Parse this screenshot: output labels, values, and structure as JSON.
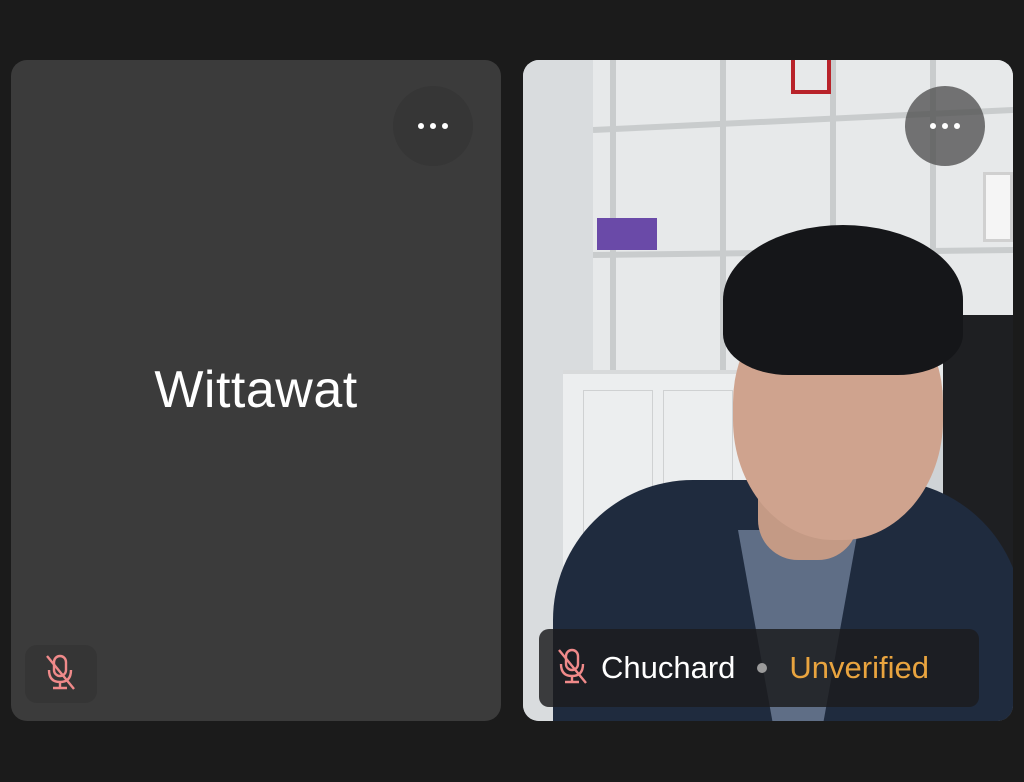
{
  "participants": [
    {
      "name": "Wittawat",
      "video": false,
      "muted": true,
      "icons": {
        "more": "more-horizontal-icon",
        "mute": "microphone-off-icon"
      }
    },
    {
      "name": "Chuchard",
      "video": true,
      "muted": true,
      "status": "Unverified",
      "icons": {
        "more": "more-horizontal-icon",
        "mute": "microphone-off-icon"
      }
    }
  ],
  "colors": {
    "background": "#1b1b1b",
    "tile": "#3b3b3b",
    "mute_icon": "#f08a8a",
    "unverified": "#e9a43f",
    "text": "#ffffff"
  }
}
